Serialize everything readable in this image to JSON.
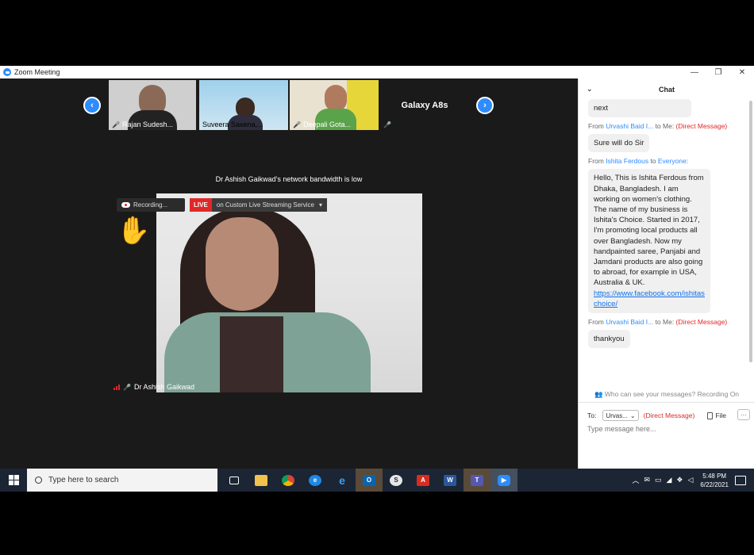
{
  "window": {
    "title": "Zoom Meeting",
    "minimize": "—",
    "maximize": "❐",
    "close": "✕"
  },
  "gallery": {
    "thumbnails": [
      {
        "name": "Rajan Sudesh..."
      },
      {
        "name": "Suveera Saxena,..."
      },
      {
        "name": "Deepali Gota..."
      },
      {
        "name": "Galaxy A8s"
      }
    ],
    "prev_icon": "chevron-left-icon",
    "next_icon": "chevron-right-icon"
  },
  "status": {
    "bandwidth_notice": "Dr  Ashish Gaikwad's network bandwidth is low"
  },
  "main_video": {
    "recording_label": "Recording...",
    "live_label": "LIVE",
    "live_service": "on Custom Live Streaming Service",
    "participant_name": "Dr  Ashish Gaikwad",
    "hand_emoji": "✋"
  },
  "chat": {
    "title": "Chat",
    "messages": [
      {
        "text": "next"
      },
      {
        "from_prefix": "From ",
        "sender": "Urvashi Baid I...",
        "to_prefix": " to Me: ",
        "tag": "(Direct Message)",
        "text": "Sure will do Sir"
      },
      {
        "from_prefix": "From ",
        "sender": "Ishita Ferdous",
        "to_prefix": " to ",
        "recipient": "Everyone",
        "after": ":",
        "text": "Hello, This is Ishita Ferdous from Dhaka, Bangladesh. I am working on women's clothing. The name of my business is Ishita's Choice. Started in 2017, I'm promoting local products all over Bangladesh. Now my handpainted saree, Panjabi and Jamdani products are also going to abroad, for example in USA, Australia & UK.",
        "link": "https://www.facebook.com/ishitaschoice/"
      },
      {
        "from_prefix": "From ",
        "sender": "Urvashi Baid I...",
        "to_prefix": " to Me: ",
        "tag": "(Direct Message)",
        "text": "thankyou"
      }
    ],
    "visibility_note": "Who can see your messages? Recording On",
    "to_label": "To:",
    "to_value": "Urvas...",
    "to_tag": "(Direct Message)",
    "file_label": "File",
    "more_label": "···",
    "input_placeholder": "Type message here..."
  },
  "taskbar": {
    "search_placeholder": "Type here to search",
    "time": "5:48 PM",
    "date": "6/22/2021",
    "apps": [
      "task-view-icon",
      "file-explorer-icon",
      "chrome-icon",
      "edge-icon",
      "internet-explorer-icon",
      "outlook-icon",
      "skype-icon",
      "acrobat-icon",
      "word-icon",
      "teams-icon",
      "zoom-icon"
    ]
  },
  "colors": {
    "zoom_blue": "#2d8cff",
    "live_red": "#e02828",
    "taskbar": "#1c2533"
  }
}
